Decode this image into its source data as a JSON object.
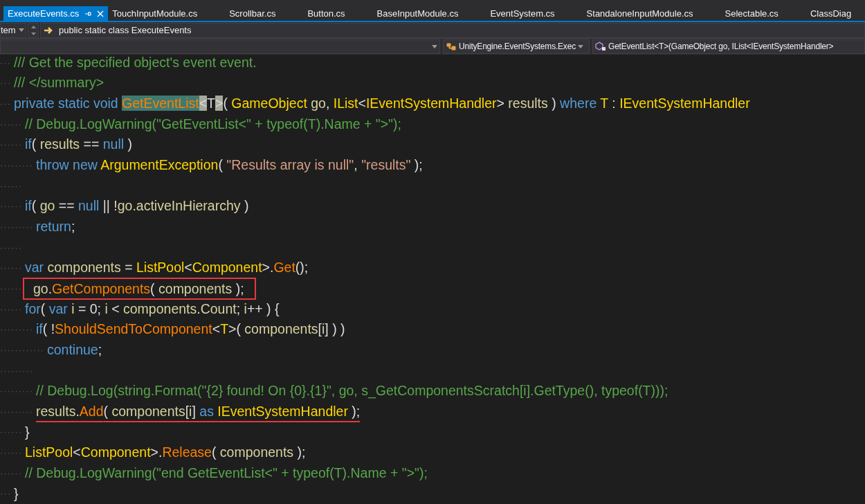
{
  "tabs": [
    {
      "label": "ExecuteEvents.cs",
      "selected": true
    },
    {
      "label": "TouchInputModule.cs",
      "selected": false
    },
    {
      "label": "Scrollbar.cs",
      "selected": false
    },
    {
      "label": "Button.cs",
      "selected": false
    },
    {
      "label": "BaseInputModule.cs",
      "selected": false
    },
    {
      "label": "EventSystem.cs",
      "selected": false
    },
    {
      "label": "StandaloneInputModule.cs",
      "selected": false
    },
    {
      "label": "Selectable.cs",
      "selected": false
    },
    {
      "label": "ClassDiag",
      "selected": false
    }
  ],
  "navigation_bar": {
    "project_dropdown": "tem",
    "class_field": "public static class ExecuteEvents",
    "type_dropdown": "UnityEngine.EventSystems.Exec",
    "member_dropdown": "GetEventList<T>(GameObject go, IList<IEventSystemHandler>"
  },
  "code_lines": [
    {
      "tokens": [
        {
          "kind": "ws",
          "text": "···"
        },
        {
          "kind": "comment",
          "text": "/// Get the specified object's event event."
        }
      ]
    },
    {
      "tokens": [
        {
          "kind": "ws",
          "text": "···"
        },
        {
          "kind": "comment",
          "text": "/// </summary>"
        }
      ]
    },
    {
      "tokens": [
        {
          "kind": "ws",
          "text": "···"
        },
        {
          "kind": "keyword",
          "text": "private static void "
        },
        {
          "kind": "selected-method",
          "text": "GetEventList"
        },
        {
          "kind": "matched-brace",
          "text": "<"
        },
        {
          "kind": "plain",
          "text": "T"
        },
        {
          "kind": "matched-brace",
          "text": ">"
        },
        {
          "kind": "plain",
          "text": "( "
        },
        {
          "kind": "type",
          "text": "GameObject"
        },
        {
          "kind": "var",
          "text": " go"
        },
        {
          "kind": "plain",
          "text": ", "
        },
        {
          "kind": "type",
          "text": "IList"
        },
        {
          "kind": "plain",
          "text": "<"
        },
        {
          "kind": "type",
          "text": "IEventSystemHandler"
        },
        {
          "kind": "plain",
          "text": "> "
        },
        {
          "kind": "var",
          "text": "results"
        },
        {
          "kind": "plain",
          "text": " ) "
        },
        {
          "kind": "keyword",
          "text": "where "
        },
        {
          "kind": "type",
          "text": "T"
        },
        {
          "kind": "plain",
          "text": " : "
        },
        {
          "kind": "type",
          "text": "IEventSystemHandler"
        }
      ]
    },
    {
      "tokens": [
        {
          "kind": "ws",
          "text": "······"
        },
        {
          "kind": "comment",
          "text": "// Debug.LogWarning(\"GetEventList<\" + typeof(T).Name + \">\");"
        }
      ]
    },
    {
      "tokens": [
        {
          "kind": "ws",
          "text": "······"
        },
        {
          "kind": "keyword",
          "text": "if"
        },
        {
          "kind": "plain",
          "text": "( "
        },
        {
          "kind": "var",
          "text": "results"
        },
        {
          "kind": "plain",
          "text": " == "
        },
        {
          "kind": "keyword",
          "text": "null"
        },
        {
          "kind": "plain",
          "text": " )"
        }
      ]
    },
    {
      "tokens": [
        {
          "kind": "ws",
          "text": "·········"
        },
        {
          "kind": "keyword",
          "text": "throw new "
        },
        {
          "kind": "type",
          "text": "ArgumentException"
        },
        {
          "kind": "plain",
          "text": "( "
        },
        {
          "kind": "string",
          "text": "\"Results array is null\""
        },
        {
          "kind": "plain",
          "text": ", "
        },
        {
          "kind": "string",
          "text": "\"results\""
        },
        {
          "kind": "plain",
          "text": " );"
        }
      ]
    },
    {
      "tokens": [
        {
          "kind": "ws",
          "text": "······"
        }
      ]
    },
    {
      "tokens": [
        {
          "kind": "ws",
          "text": "······"
        },
        {
          "kind": "keyword",
          "text": "if"
        },
        {
          "kind": "plain",
          "text": "( "
        },
        {
          "kind": "var",
          "text": "go"
        },
        {
          "kind": "plain",
          "text": " == "
        },
        {
          "kind": "keyword",
          "text": "null"
        },
        {
          "kind": "plain",
          "text": " || !"
        },
        {
          "kind": "var",
          "text": "go"
        },
        {
          "kind": "plain",
          "text": "."
        },
        {
          "kind": "var",
          "text": "activeInHierarchy"
        },
        {
          "kind": "plain",
          "text": " )"
        }
      ]
    },
    {
      "tokens": [
        {
          "kind": "ws",
          "text": "·········"
        },
        {
          "kind": "keyword",
          "text": "return"
        },
        {
          "kind": "plain",
          "text": ";"
        }
      ]
    },
    {
      "tokens": [
        {
          "kind": "ws",
          "text": "······"
        }
      ]
    },
    {
      "tokens": [
        {
          "kind": "ws",
          "text": "······"
        },
        {
          "kind": "keyword",
          "text": "var "
        },
        {
          "kind": "var",
          "text": "components"
        },
        {
          "kind": "plain",
          "text": " = "
        },
        {
          "kind": "type",
          "text": "ListPool"
        },
        {
          "kind": "plain",
          "text": "<"
        },
        {
          "kind": "type",
          "text": "Component"
        },
        {
          "kind": "plain",
          "text": ">."
        },
        {
          "kind": "method",
          "text": "Get"
        },
        {
          "kind": "plain",
          "text": "();"
        }
      ]
    },
    {
      "boxed": true,
      "tokens": [
        {
          "kind": "ws",
          "text": "······"
        },
        {
          "kind": "var",
          "text": "go"
        },
        {
          "kind": "plain",
          "text": "."
        },
        {
          "kind": "method",
          "text": "GetComponents"
        },
        {
          "kind": "plain",
          "text": "( "
        },
        {
          "kind": "var",
          "text": "components"
        },
        {
          "kind": "plain",
          "text": " );"
        }
      ]
    },
    {
      "tokens": [
        {
          "kind": "ws",
          "text": "······"
        },
        {
          "kind": "keyword",
          "text": "for"
        },
        {
          "kind": "plain",
          "text": "( "
        },
        {
          "kind": "keyword",
          "text": "var "
        },
        {
          "kind": "var",
          "text": "i"
        },
        {
          "kind": "plain",
          "text": " = 0; "
        },
        {
          "kind": "var",
          "text": "i"
        },
        {
          "kind": "plain",
          "text": " < "
        },
        {
          "kind": "var",
          "text": "components"
        },
        {
          "kind": "plain",
          "text": "."
        },
        {
          "kind": "var",
          "text": "Count"
        },
        {
          "kind": "plain",
          "text": "; "
        },
        {
          "kind": "var",
          "text": "i"
        },
        {
          "kind": "plain",
          "text": "++ ) {"
        }
      ]
    },
    {
      "tokens": [
        {
          "kind": "ws",
          "text": "·········"
        },
        {
          "kind": "keyword",
          "text": "if"
        },
        {
          "kind": "plain",
          "text": "( !"
        },
        {
          "kind": "method",
          "text": "ShouldSendToComponent"
        },
        {
          "kind": "plain",
          "text": "<"
        },
        {
          "kind": "type",
          "text": "T"
        },
        {
          "kind": "plain",
          "text": ">( "
        },
        {
          "kind": "var",
          "text": "components"
        },
        {
          "kind": "plain",
          "text": "["
        },
        {
          "kind": "var",
          "text": "i"
        },
        {
          "kind": "plain",
          "text": "] ) )"
        }
      ]
    },
    {
      "tokens": [
        {
          "kind": "ws",
          "text": "············"
        },
        {
          "kind": "keyword",
          "text": "continue"
        },
        {
          "kind": "plain",
          "text": ";"
        }
      ]
    },
    {
      "tokens": [
        {
          "kind": "ws",
          "text": "·········"
        }
      ]
    },
    {
      "tokens": [
        {
          "kind": "ws",
          "text": "·········"
        },
        {
          "kind": "comment",
          "text": "// Debug.Log(string.Format(\"{2} found! On {0}.{1}\", go, s_GetComponentsScratch[i].GetType(), typeof(T)));"
        }
      ]
    },
    {
      "underlined": true,
      "tokens": [
        {
          "kind": "ws",
          "text": "·········"
        },
        {
          "kind": "var",
          "text": "results"
        },
        {
          "kind": "plain",
          "text": "."
        },
        {
          "kind": "method",
          "text": "Add"
        },
        {
          "kind": "plain",
          "text": "( "
        },
        {
          "kind": "var",
          "text": "components"
        },
        {
          "kind": "plain",
          "text": "["
        },
        {
          "kind": "var",
          "text": "i"
        },
        {
          "kind": "plain",
          "text": "] "
        },
        {
          "kind": "keyword",
          "text": "as "
        },
        {
          "kind": "type",
          "text": "IEventSystemHandler"
        },
        {
          "kind": "plain",
          "text": " );"
        }
      ]
    },
    {
      "tokens": [
        {
          "kind": "ws",
          "text": "······"
        },
        {
          "kind": "plain",
          "text": "}"
        }
      ]
    },
    {
      "tokens": [
        {
          "kind": "ws",
          "text": "······"
        },
        {
          "kind": "type",
          "text": "ListPool"
        },
        {
          "kind": "plain",
          "text": "<"
        },
        {
          "kind": "type",
          "text": "Component"
        },
        {
          "kind": "plain",
          "text": ">."
        },
        {
          "kind": "method",
          "text": "Release"
        },
        {
          "kind": "plain",
          "text": "( "
        },
        {
          "kind": "var",
          "text": "components"
        },
        {
          "kind": "plain",
          "text": " );"
        }
      ]
    },
    {
      "tokens": [
        {
          "kind": "ws",
          "text": "······"
        },
        {
          "kind": "comment",
          "text": "// Debug.LogWarning(\"end GetEventList<\" + typeof(T).Name + \">\");"
        }
      ]
    },
    {
      "tokens": [
        {
          "kind": "ws",
          "text": "···"
        },
        {
          "kind": "plain",
          "text": "}"
        }
      ]
    }
  ]
}
